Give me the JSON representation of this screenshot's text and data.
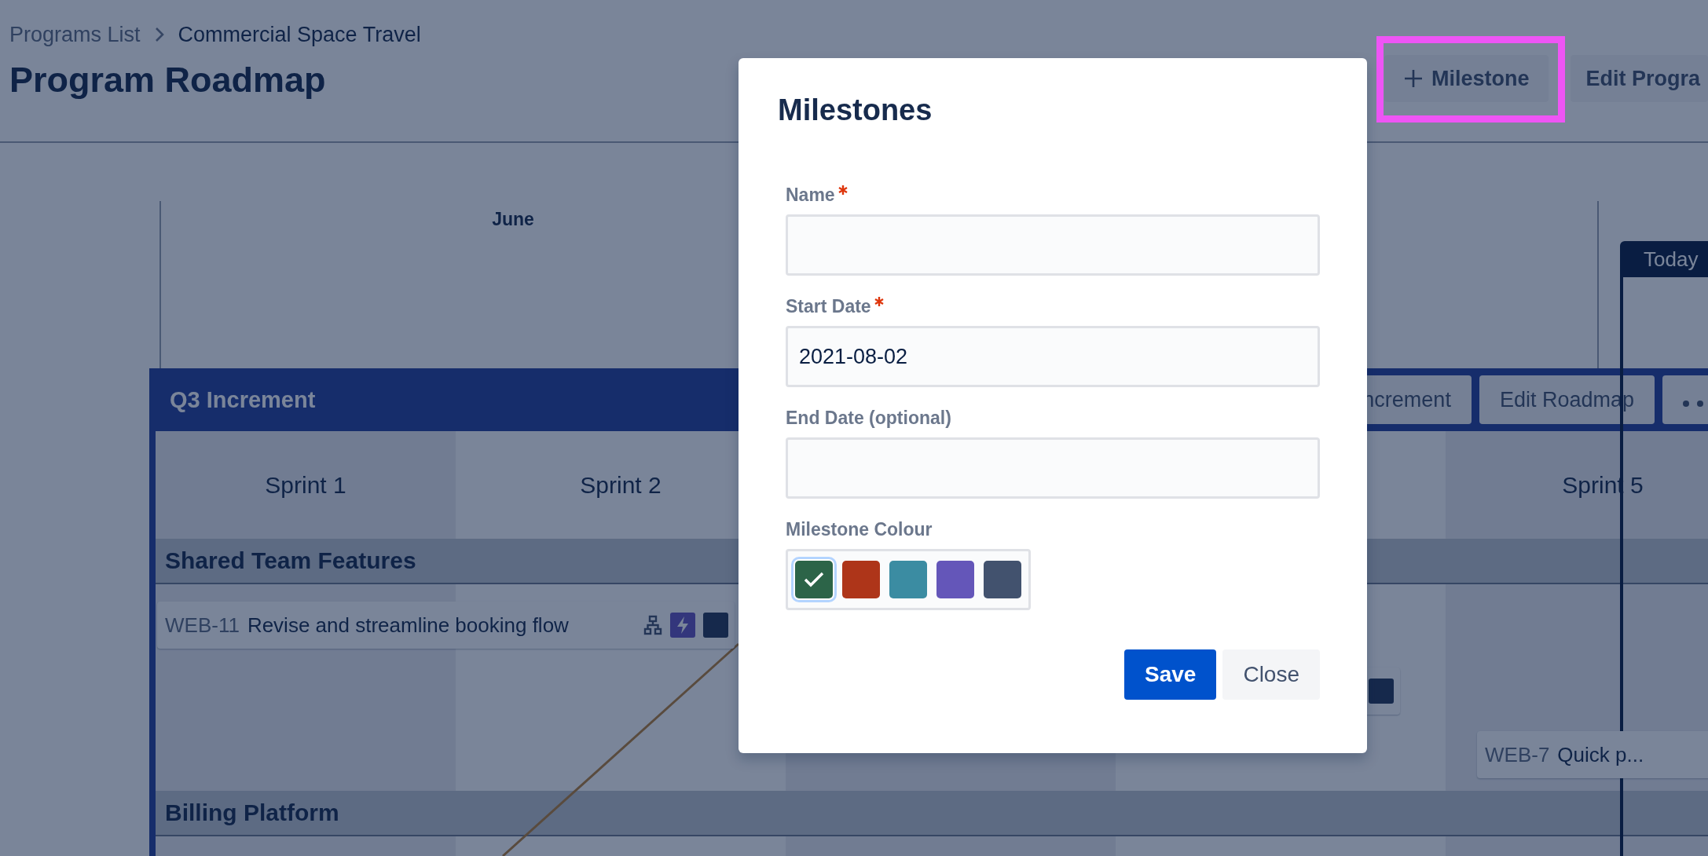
{
  "breadcrumbs": [
    "Programs List",
    "Commercial Space Travel"
  ],
  "page_title": "Program Roadmap",
  "header_actions": [
    {
      "label": "Milestone",
      "kind": "add",
      "highlighted": true
    },
    {
      "label": "Edit Progra",
      "kind": "plain",
      "highlighted": false
    }
  ],
  "timeline": {
    "months": [
      "June"
    ],
    "today_label": "Today"
  },
  "increment": {
    "title": "Q3 Increment",
    "actions": [
      {
        "label": "ncrement",
        "kind": "text"
      },
      {
        "label": "Edit Roadmap",
        "kind": "text"
      },
      {
        "kind": "more"
      }
    ]
  },
  "sprints": [
    {
      "label": "Sprint 1"
    },
    {
      "label": "Sprint 2"
    },
    {
      "label": "Sprint 5"
    }
  ],
  "teams": [
    {
      "name": "Shared Team Features",
      "cards": [
        {
          "key": "WEB-11",
          "title": "Revise and streamline booking flow",
          "has_children": true
        },
        {
          "key": "WEB-7",
          "title": "Quick p..."
        }
      ]
    },
    {
      "name": "Billing Platform"
    }
  ],
  "modal": {
    "title": "Milestones",
    "fields": [
      {
        "label": "Name",
        "required": true
      },
      {
        "label": "Start Date",
        "required": true,
        "value": "2021-08-02"
      },
      {
        "label": "End Date (optional)",
        "required": false
      }
    ],
    "colour": {
      "label": "Milestone Colour",
      "swatches": [
        {
          "color": "#2c6448",
          "selected": true
        },
        {
          "color": "#ae3519",
          "selected": false
        },
        {
          "color": "#3b8ca2",
          "selected": false
        },
        {
          "color": "#6456b9",
          "selected": false
        },
        {
          "color": "#42526e",
          "selected": false
        }
      ]
    },
    "buttons": [
      {
        "label": "Save",
        "kind": "primary"
      },
      {
        "label": "Close",
        "kind": "subtle"
      }
    ]
  }
}
